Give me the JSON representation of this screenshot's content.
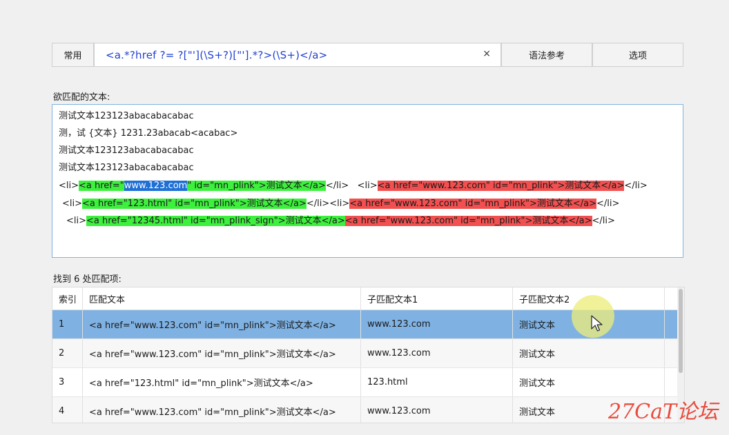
{
  "toolbar": {
    "common_label": "常用",
    "regex_value": "<a.*?href ?= ?[\"'](\\S+?)[\"'].*?>(\\S+)</a>",
    "clear_glyph": "×",
    "syntax_label": "语法参考",
    "options_label": "选项"
  },
  "input_section": {
    "label": "欲匹配的文本:",
    "lines": {
      "l1": "测试文本123123abacabacabac",
      "l2": "测，试 {文本} 1231.23abacab<acabac>",
      "l3": "测试文本123123abacabacabac",
      "l4": "测试文本123123abacabacabac",
      "l5": {
        "a": "<li>",
        "m1_pre": "<a href=\"",
        "m1_sel": "www.123.com",
        "m1_post": "\" id=\"mn_plink\">测试文本</a>",
        "b": "</li>   <li>",
        "m2": "<a href=\"www.123.com\" id=\"mn_plink\">测试文本</a>",
        "c": "</li>"
      },
      "l6": {
        "a": "<li>",
        "m1": "<a href=\"123.html\" id=\"mn_plink\">测试文本</a>",
        "b": "</li><li>",
        "m2": "<a href=\"www.123.com\" id=\"mn_plink\">测试文本</a>",
        "c": "</li>"
      },
      "l7": {
        "a": "<li>",
        "m1": "<a href=\"12345.html\" id=\"mn_plink_sign\">测试文本</a>",
        "m2": "<a href=\"www.123.com\" id=\"mn_plink\">测试文本</a>",
        "c": "</li>"
      }
    }
  },
  "results": {
    "label": "找到 6 处匹配项:",
    "columns": [
      "索引",
      "匹配文本",
      "子匹配文本1",
      "子匹配文本2"
    ],
    "rows": [
      {
        "index": "1",
        "match": "<a  href=\"www.123.com\"  id=\"mn_plink\">测试文本</a>",
        "sub1": "www.123.com",
        "sub2": "测试文本"
      },
      {
        "index": "2",
        "match": "<a  href=\"www.123.com\"  id=\"mn_plink\">测试文本</a>",
        "sub1": "www.123.com",
        "sub2": "测试文本"
      },
      {
        "index": "3",
        "match": "<a  href=\"123.html\"  id=\"mn_plink\">测试文本</a>",
        "sub1": "123.html",
        "sub2": "测试文本"
      },
      {
        "index": "4",
        "match": "<a  href=\"www.123.com\"  id=\"mn_plink\">测试文本</a>",
        "sub1": "www.123.com",
        "sub2": "测试文本"
      }
    ]
  },
  "watermark": "27CaT论坛",
  "colors": {
    "match_green": "#3ef03e",
    "match_red": "#f25050",
    "selection_blue": "#1e6fd6",
    "selected_row": "#7fb2e3",
    "regex_text": "#1f3fd1",
    "watermark": "#e84c3d"
  }
}
